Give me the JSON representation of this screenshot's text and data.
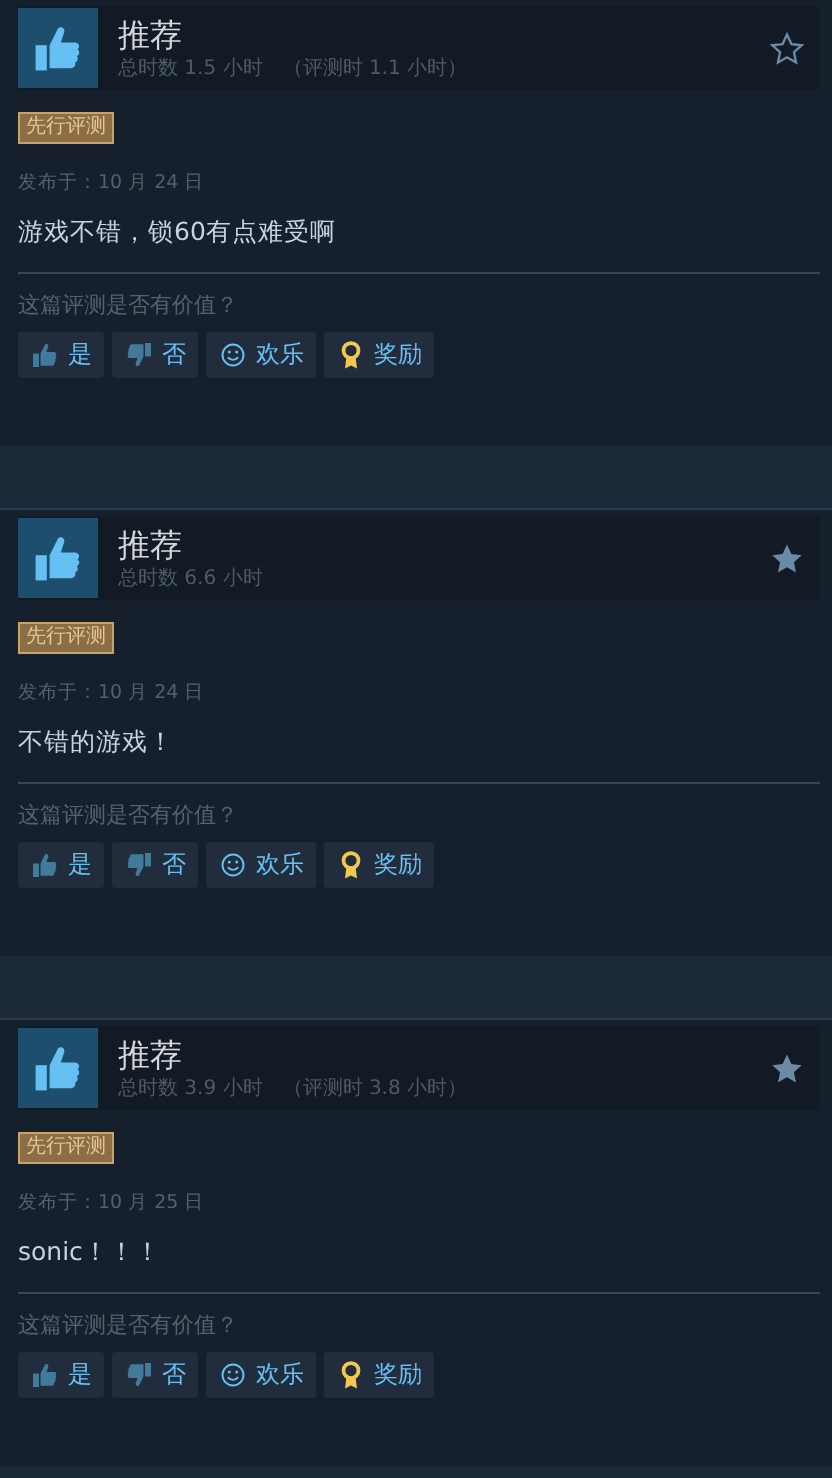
{
  "reviews": [
    {
      "verdict": "推荐",
      "playtime": "总时数 1.5 小时",
      "review_time": "（评测时 1.1 小时）",
      "starred": false,
      "badge": "先行评测",
      "posted": "发布于：10 月 24 日",
      "text": "游戏不错，锁60有点难受啊",
      "question": "这篇评测是否有价值？",
      "buttons": [
        {
          "kind": "yes",
          "label": "是"
        },
        {
          "kind": "no",
          "label": "否"
        },
        {
          "kind": "funny",
          "label": "欢乐"
        },
        {
          "kind": "award",
          "label": "奖励"
        }
      ]
    },
    {
      "verdict": "推荐",
      "playtime": "总时数 6.6 小时",
      "starred": true,
      "badge": "先行评测",
      "posted": "发布于：10 月 24 日",
      "text": "不错的游戏！",
      "question": "这篇评测是否有价值？",
      "buttons": [
        {
          "kind": "yes",
          "label": "是"
        },
        {
          "kind": "no",
          "label": "否"
        },
        {
          "kind": "funny",
          "label": "欢乐"
        },
        {
          "kind": "award",
          "label": "奖励"
        }
      ]
    },
    {
      "verdict": "推荐",
      "playtime": "总时数 3.9 小时",
      "review_time": "（评测时 3.8 小时）",
      "starred": true,
      "badge": "先行评测",
      "posted": "发布于：10 月 25 日",
      "text": "sonic！！！",
      "question": "这篇评测是否有价值？",
      "buttons": [
        {
          "kind": "yes",
          "label": "是"
        },
        {
          "kind": "no",
          "label": "否"
        },
        {
          "kind": "funny",
          "label": "欢乐"
        },
        {
          "kind": "award",
          "label": "奖励"
        }
      ]
    }
  ]
}
